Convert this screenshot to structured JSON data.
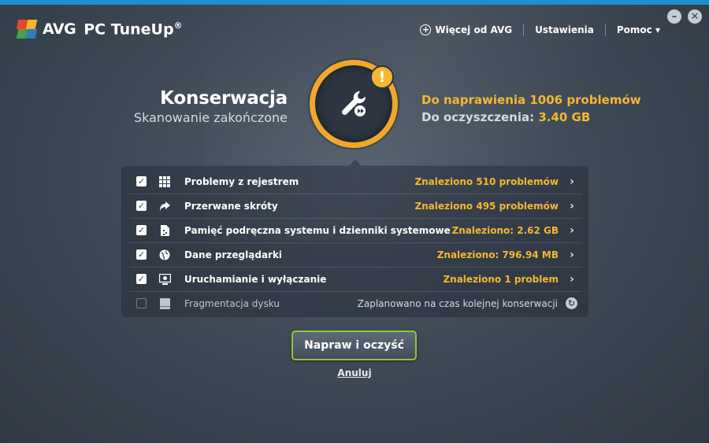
{
  "app": {
    "brand": "AVG",
    "product": "PC TuneUp",
    "registered": "®",
    "accent_color": "#f5b731",
    "button_border_color": "#8ec63f"
  },
  "nav": {
    "more": "Więcej od AVG",
    "settings": "Ustawienia",
    "help": "Pomoc ▾"
  },
  "window_controls": {
    "minimize": "–",
    "close": "✕"
  },
  "header": {
    "title": "Konserwacja",
    "subtitle": "Skanowanie zakończone",
    "problems_text": "Do naprawienia 1006 problemów",
    "cleanup_label": "Do oczyszczenia:",
    "cleanup_value": "3.40 GB",
    "warning_glyph": "!"
  },
  "items": [
    {
      "checked": true,
      "icon": "registry-grid-icon",
      "label": "Problemy z rejestrem",
      "status": "Znaleziono 510 problemów",
      "action": "chevron-right-icon"
    },
    {
      "checked": true,
      "icon": "shortcut-arrow-icon",
      "label": "Przerwane skróty",
      "status": "Znaleziono 495 problemów",
      "action": "chevron-right-icon"
    },
    {
      "checked": true,
      "icon": "system-cache-icon",
      "label": "Pamięć podręczna systemu i dzienniki systemowe",
      "status": "Znaleziono: 2.62 GB",
      "action": "chevron-right-icon"
    },
    {
      "checked": true,
      "icon": "browser-globe-icon",
      "label": "Dane przeglądarki",
      "status": "Znaleziono: 796.94 MB",
      "action": "chevron-right-icon"
    },
    {
      "checked": true,
      "icon": "monitor-startup-icon",
      "label": "Uruchamianie i wyłączanie",
      "status": "Znaleziono 1 problem",
      "action": "chevron-right-icon"
    },
    {
      "checked": false,
      "icon": "disk-drive-icon",
      "label": "Fragmentacja dysku",
      "status": "Zaplanowano na czas kolejnej konserwacji",
      "action": "refresh-icon"
    }
  ],
  "actions": {
    "fix": "Napraw i oczyść",
    "cancel": "Anuluj"
  }
}
